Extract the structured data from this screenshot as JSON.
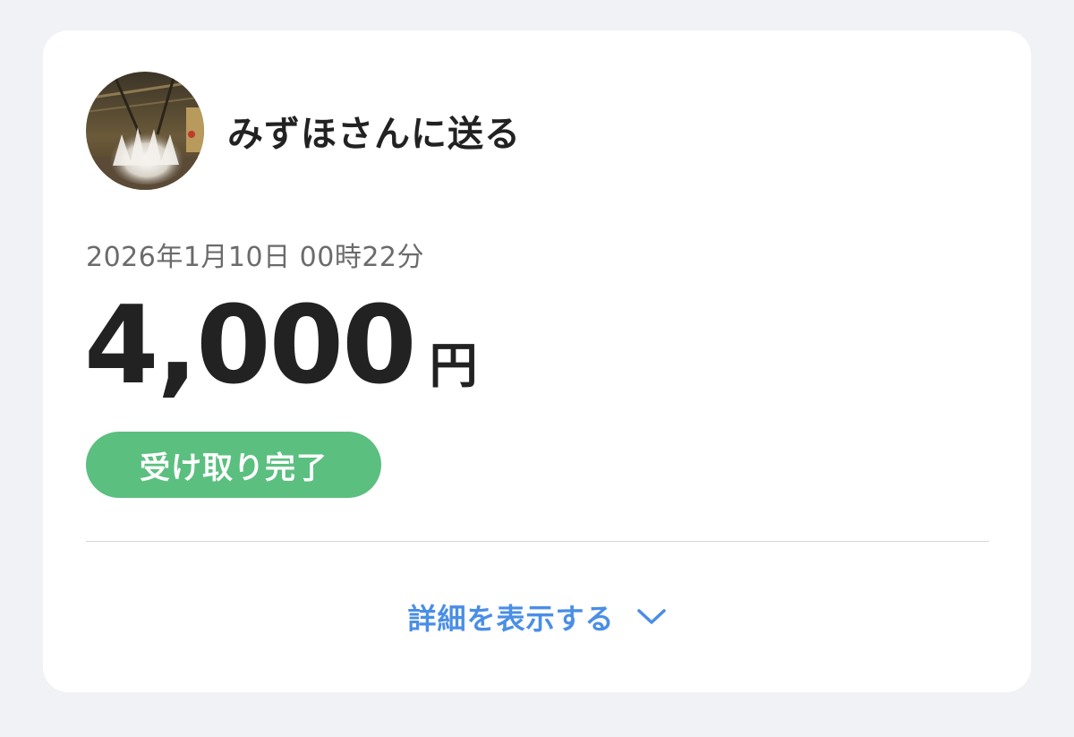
{
  "transfer": {
    "recipient_title": "みずほさんに送る",
    "datetime": "2026年1月10日 00時22分",
    "amount": "4,000",
    "currency": "円",
    "status": "受け取り完了",
    "details_label": "詳細を表示する"
  },
  "colors": {
    "status_green": "#5bbf7f",
    "link_blue": "#4a8ee6",
    "text_dark": "#222222",
    "text_gray": "#6b6b6b",
    "background": "#f1f2f6"
  },
  "icons": {
    "expand": "chevron-down-icon",
    "avatar": "user-avatar-photo"
  }
}
